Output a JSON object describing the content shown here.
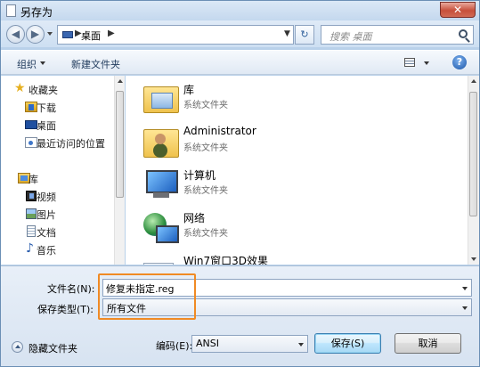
{
  "window": {
    "title": "另存为",
    "close_glyph": "✕"
  },
  "nav": {
    "back_glyph": "◀",
    "forward_glyph": "▶",
    "address": {
      "location": "桌面",
      "separator": "▶",
      "dropdown_glyph": "▼"
    },
    "refresh_glyph": "↻",
    "search": {
      "placeholder": "搜索 桌面"
    }
  },
  "toolbar": {
    "organize_label": "组织",
    "new_folder_label": "新建文件夹",
    "help_glyph": "?"
  },
  "sidebar": {
    "items": [
      {
        "label": "收藏夹",
        "icon": "star-icon"
      },
      {
        "label": "下载",
        "icon": "download-icon"
      },
      {
        "label": "桌面",
        "icon": "desktop-icon"
      },
      {
        "label": "最近访问的位置",
        "icon": "recent-icon"
      },
      {
        "label": "库",
        "icon": "library-icon"
      },
      {
        "label": "视频",
        "icon": "video-icon"
      },
      {
        "label": "图片",
        "icon": "picture-icon"
      },
      {
        "label": "文档",
        "icon": "doc-icon"
      },
      {
        "label": "音乐",
        "icon": "music-icon"
      }
    ],
    "star_glyph": "★",
    "music_glyph": "♪"
  },
  "files": [
    {
      "name": "库",
      "type": "系统文件夹",
      "icon": "library-folder-icon"
    },
    {
      "name": "Administrator",
      "type": "系统文件夹",
      "icon": "user-folder-icon"
    },
    {
      "name": "计算机",
      "type": "系统文件夹",
      "icon": "computer-icon"
    },
    {
      "name": "网络",
      "type": "系统文件夹",
      "icon": "network-icon"
    },
    {
      "name": "Win7窗口3D效果",
      "type": "",
      "icon": "file-icon"
    }
  ],
  "form": {
    "filename_label": "文件名(N):",
    "filename_value": "修复未指定.reg",
    "savetype_label": "保存类型(T):",
    "savetype_value": "所有文件",
    "encoding_label": "编码(E):",
    "encoding_value": "ANSI",
    "hide_folders_label": "隐藏文件夹",
    "save_label": "保存(S)",
    "cancel_label": "取消"
  },
  "colors": {
    "highlight": "#f08a24",
    "frame": "#b9d1ea",
    "accent": "#3c7fb1"
  }
}
